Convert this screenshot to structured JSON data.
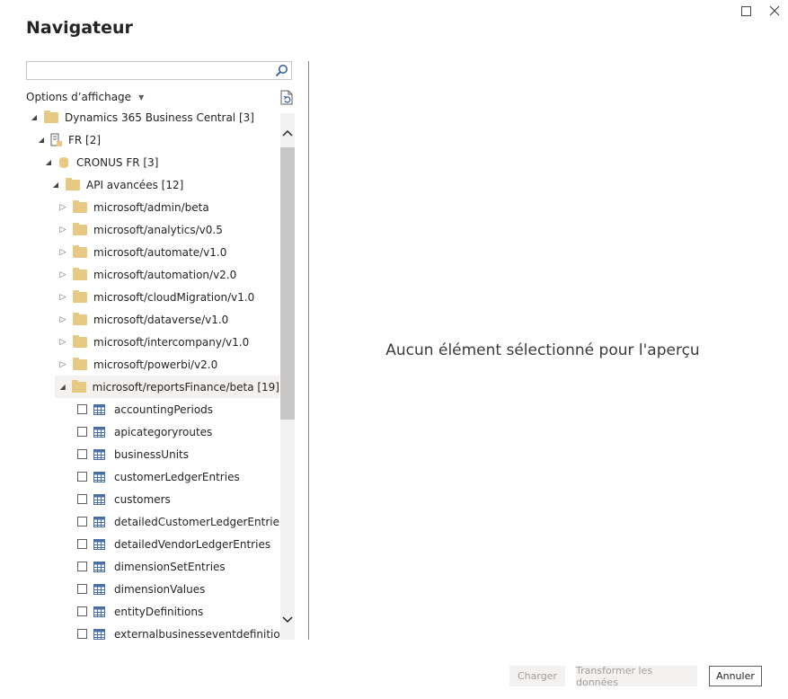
{
  "window": {
    "title": "Navigateur",
    "maximize_icon": "maximize-icon",
    "close_icon": "close-icon"
  },
  "search": {
    "value": "",
    "placeholder": "",
    "icon": "search-icon"
  },
  "display_options": {
    "label": "Options d’affichage",
    "caret_icon": "caret-down-icon",
    "refresh_icon": "refresh-icon"
  },
  "tree": {
    "root": {
      "label": "Dynamics 365 Business Central [3]",
      "expanded": true
    },
    "fr": {
      "label": "FR [2]",
      "expanded": true
    },
    "cronus": {
      "label": "CRONUS  FR [3]",
      "expanded": true
    },
    "api": {
      "label": "API avancées [12]",
      "expanded": true
    },
    "folders": [
      {
        "label": "microsoft/admin/beta"
      },
      {
        "label": "microsoft/analytics/v0.5"
      },
      {
        "label": "microsoft/automate/v1.0"
      },
      {
        "label": "microsoft/automation/v2.0"
      },
      {
        "label": "microsoft/cloudMigration/v1.0"
      },
      {
        "label": "microsoft/dataverse/v1.0"
      },
      {
        "label": "microsoft/intercompany/v1.0"
      },
      {
        "label": "microsoft/powerbi/v2.0"
      }
    ],
    "expanded_folder": {
      "label": "microsoft/reportsFinance/beta [19]"
    },
    "tables": [
      {
        "label": "accountingPeriods",
        "checked": false
      },
      {
        "label": "apicategoryroutes",
        "checked": false
      },
      {
        "label": "businessUnits",
        "checked": false
      },
      {
        "label": "customerLedgerEntries",
        "checked": false
      },
      {
        "label": "customers",
        "checked": false
      },
      {
        "label": "detailedCustomerLedgerEntries",
        "checked": false
      },
      {
        "label": "detailedVendorLedgerEntries",
        "checked": false
      },
      {
        "label": "dimensionSetEntries",
        "checked": false
      },
      {
        "label": "dimensionValues",
        "checked": false
      },
      {
        "label": "entityDefinitions",
        "checked": false
      },
      {
        "label": "externalbusinesseventdefinitions",
        "checked": false
      }
    ]
  },
  "preview": {
    "message": "Aucun élément sélectionné pour l'aperçu"
  },
  "footer": {
    "load_label": "Charger",
    "transform_label": "Transformer les données",
    "cancel_label": "Annuler"
  },
  "colors": {
    "folder": "#e8c983",
    "table_icon": "#4a6fa5",
    "divider": "#8a8886",
    "disabled_bg": "#f3f2f1"
  }
}
